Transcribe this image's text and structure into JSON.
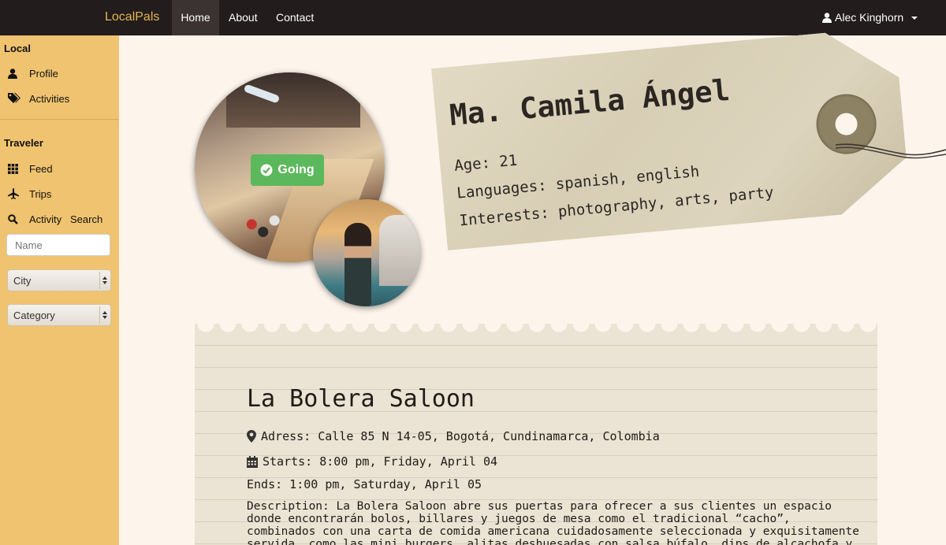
{
  "navbar": {
    "brand": "LocalPals",
    "links": [
      {
        "label": "Home",
        "active": true
      },
      {
        "label": "About",
        "active": false
      },
      {
        "label": "Contact",
        "active": false
      }
    ],
    "user": {
      "name": "Alec Kinghorn",
      "icon": "user-icon"
    }
  },
  "sidebar": {
    "local_heading": "Local",
    "local_items": [
      {
        "label": "Profile",
        "icon": "user-icon"
      },
      {
        "label": "Activities",
        "icon": "tags-icon"
      }
    ],
    "traveler_heading": "Traveler",
    "traveler_items": [
      {
        "label": "Feed",
        "icon": "grid-icon"
      },
      {
        "label": "Trips",
        "icon": "plane-icon"
      },
      {
        "label": "Activity   Search",
        "icon": "search-icon"
      }
    ],
    "search": {
      "name_placeholder": "Name",
      "city_value": "City",
      "category_value": "Category"
    }
  },
  "profile": {
    "status_button": "Going",
    "name": "Ma. Camila Ángel",
    "age": "Age: 21",
    "languages": "Languages: spanish, english",
    "interests": "Interests: photography, arts, party"
  },
  "activity": {
    "title": "La Bolera Saloon",
    "address": "Adress: Calle 85 N 14-05, Bogotá, Cundinamarca, Colombia",
    "starts": "Starts: 8:00 pm, Friday, April 04",
    "ends": "Ends: 1:00 pm, Saturday, April 05",
    "description": "Description: La Bolera Saloon abre sus puertas para ofrecer a sus clientes un espacio donde encontrarán bolos, billares y juegos de mesa como el tradicional “cacho”, combinados con una carta de comida americana cuidadosamente seleccionada y exquisitamente servida, como las mini burgers, alitas deshuesadas con salsa búfalo, dips de alcachofa y espinaca, entre otros. El"
  },
  "colors": {
    "navbar": "#221c1c",
    "brand": "#e3b64d",
    "sidebar": "#efc36f",
    "background": "#fdf5ec",
    "going": "#5cb85c"
  }
}
